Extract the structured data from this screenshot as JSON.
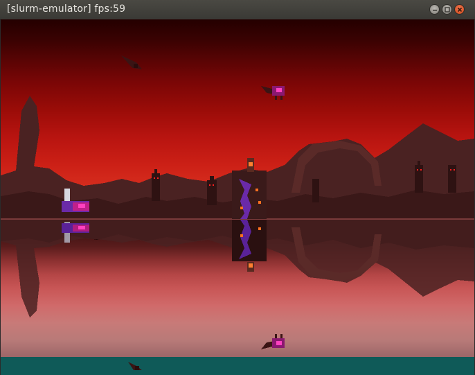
{
  "window": {
    "title": "[slurm-emulator] fps:59",
    "buttons": {
      "minimize": "minimize-icon",
      "maximize": "maximize-icon",
      "close": "close-icon"
    }
  },
  "scene": {
    "colors": {
      "sky_top": "#240000",
      "sky_horizon": "#de3c24",
      "rocks": "#4a2222",
      "rocks_dark": "#2e1212",
      "water_reflection": "#b44646",
      "floor": "#0f5a58",
      "enemy_body": "#c0208a",
      "enemy_glow": "#ff40c0",
      "tower_purple": "#6a2aa8"
    }
  }
}
